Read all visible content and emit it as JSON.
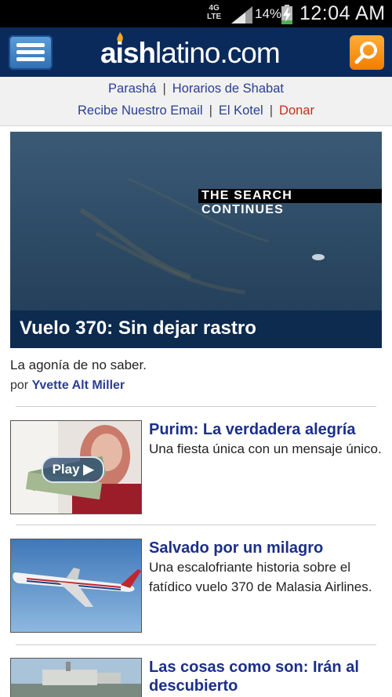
{
  "status_bar": {
    "network": "4G LTE",
    "network_top": "4G",
    "network_bottom": "LTE",
    "battery_percent": "14%",
    "time": "12:04 AM"
  },
  "header": {
    "logo_bold": "aish",
    "logo_light": "latino.com",
    "menu_icon": "hamburger-menu-icon",
    "search_icon": "search-icon"
  },
  "nav": {
    "row1": [
      "Parashá",
      "Horarios de Shabat"
    ],
    "row2": [
      "Recibe Nuestro Email",
      "El Kotel",
      "Donar"
    ],
    "separator": "|"
  },
  "hero": {
    "overlay_caption": "THE SEARCH CONTINUES",
    "title": "Vuelo 370: Sin dejar rastro",
    "teaser": "La agonía de no saber.",
    "by_prefix": "por",
    "author": "Yvette Alt Miller"
  },
  "articles": [
    {
      "title": "Purim: La verdadera alegría",
      "description": "Una fiesta única con un mensaje único.",
      "play_label": "Play"
    },
    {
      "title": "Salvado por un milagro",
      "description": "Una escalofriante historia sobre el fatídico vuelo 370 de Malasia Airlines."
    },
    {
      "title": "Las cosas como son: Irán al descubierto",
      "description": ""
    }
  ],
  "colors": {
    "header_bg": "#0b2a5c",
    "link": "#2b3f92",
    "donate": "#cc2a1a",
    "search_button": "#f07d00"
  }
}
